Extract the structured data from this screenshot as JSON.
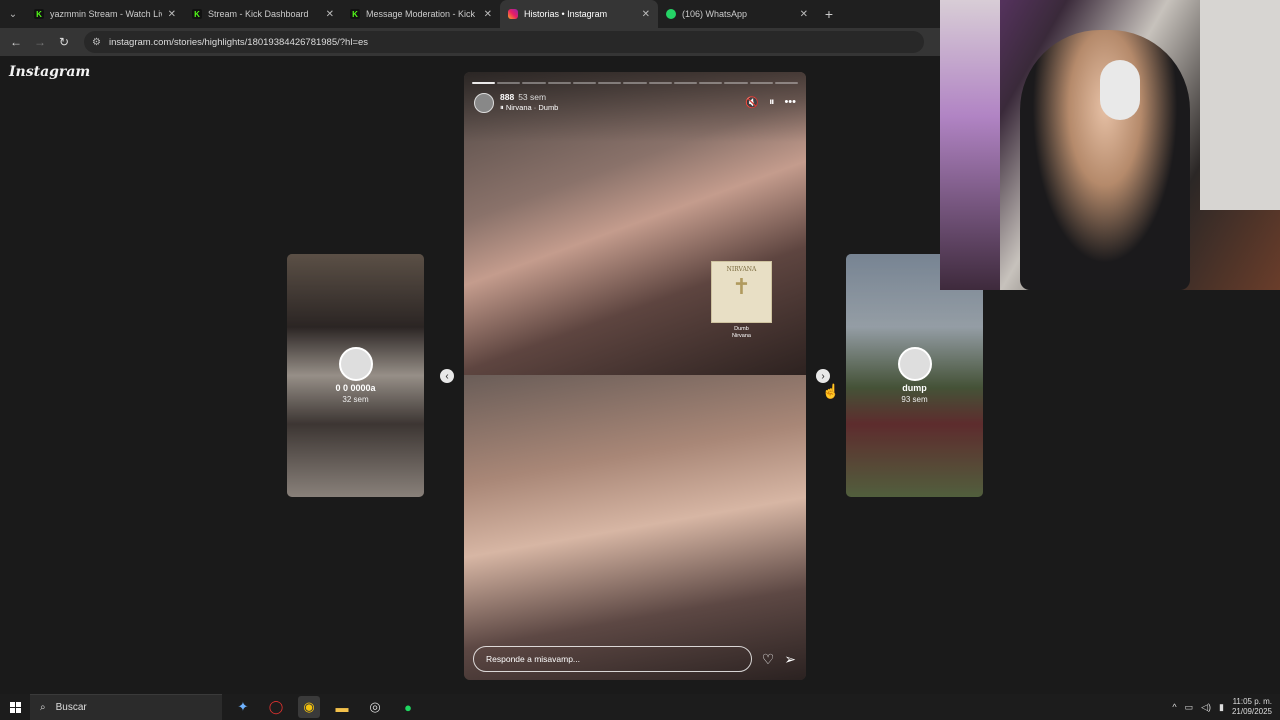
{
  "browser": {
    "tabs": [
      {
        "title": "yazmmin Stream - Watch Live o",
        "favicon": "kick-icon",
        "active": false
      },
      {
        "title": "Stream - Kick Dashboard",
        "favicon": "kick-icon",
        "active": false
      },
      {
        "title": "Message Moderation - Kick Da",
        "favicon": "kick-icon",
        "active": false
      },
      {
        "title": "Historias • Instagram",
        "favicon": "instagram-icon",
        "active": true
      },
      {
        "title": "(106) WhatsApp",
        "favicon": "whatsapp-icon",
        "active": false
      }
    ],
    "url": "instagram.com/stories/highlights/18019384426781985/?hl=es"
  },
  "instagram": {
    "logo": "Instagram",
    "left_story": {
      "name": "0 0 0000a",
      "time": "32 sem"
    },
    "right_story": {
      "name": "dump",
      "time": "93 sem"
    },
    "story": {
      "user": "888",
      "time": "53 sem",
      "song": "Nirvana · Dumb",
      "album_band": "NIRVANA",
      "album_caption_1": "Dumb",
      "album_caption_2": "Nirvana",
      "reply_placeholder": "Responde a misavamp...",
      "progress_total": 13,
      "progress_done": 1
    }
  },
  "taskbar": {
    "search_label": "Buscar",
    "time": "11:05 p. m.",
    "date": "21/09/2025"
  }
}
